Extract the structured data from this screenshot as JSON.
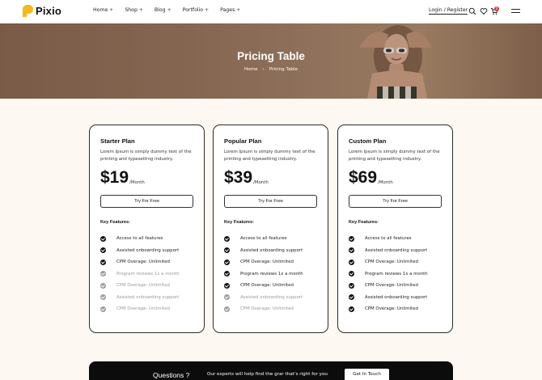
{
  "brand": {
    "name": "Pixio",
    "accent": "#f6b81d"
  },
  "nav": {
    "items": [
      {
        "label": "Home"
      },
      {
        "label": "Shop"
      },
      {
        "label": "Blog"
      },
      {
        "label": "Portfolio"
      },
      {
        "label": "Pages"
      }
    ],
    "expand_glyph": "+",
    "login_label": "Login / Register",
    "cart_count": "0"
  },
  "hero": {
    "title": "Pricing Table",
    "breadcrumb": {
      "home": "Home",
      "separator": "›",
      "current": "Pricing Table"
    }
  },
  "plans": [
    {
      "name": "Starter Plan",
      "description": "Lorem Ipsum is simply dummy text of the printing and typesetting industry.",
      "price": "$19",
      "period": "/Month",
      "cta": "Try For Free",
      "features_title": "Key Features:",
      "features": [
        {
          "label": "Access to all features",
          "included": true
        },
        {
          "label": "Assisted onboarding support",
          "included": true
        },
        {
          "label": "CPM Overage: Unlimited",
          "included": true
        },
        {
          "label": "Program reviews 1x a month",
          "included": false
        },
        {
          "label": "CPM Overage: Unlimited",
          "included": false
        },
        {
          "label": "Assisted onboarding support",
          "included": false
        },
        {
          "label": "CPM Overage: Unlimited",
          "included": false
        }
      ]
    },
    {
      "name": "Popular Plan",
      "description": "Lorem Ipsum is simply dummy text of the printing and typesetting industry.",
      "price": "$39",
      "period": "/Month",
      "cta": "Try For Free",
      "features_title": "Key Features:",
      "features": [
        {
          "label": "Access to all features",
          "included": true
        },
        {
          "label": "Assisted onboarding support",
          "included": true
        },
        {
          "label": "CPM Overage: Unlimited",
          "included": true
        },
        {
          "label": "Program reviews 1x a month",
          "included": true
        },
        {
          "label": "CPM Overage: Unlimited",
          "included": true
        },
        {
          "label": "Assisted onboarding support",
          "included": false
        },
        {
          "label": "CPM Overage: Unlimited",
          "included": false
        }
      ]
    },
    {
      "name": "Custom Plan",
      "description": "Lorem Ipsum is simply dummy text of the printing and typesetting industry.",
      "price": "$69",
      "period": "/Month",
      "cta": "Try For Free",
      "features_title": "Key Features:",
      "features": [
        {
          "label": "Access to all features",
          "included": true
        },
        {
          "label": "Assisted onboarding support",
          "included": true
        },
        {
          "label": "CPM Overage: Unlimited",
          "included": true
        },
        {
          "label": "Program reviews 1x a month",
          "included": true
        },
        {
          "label": "CPM Overage: Unlimited",
          "included": true
        },
        {
          "label": "Assisted onboarding support",
          "included": true
        },
        {
          "label": "CPM Overage: Unlimited",
          "included": true
        }
      ]
    }
  ],
  "cta_banner": {
    "question": "Questions ?",
    "text": "Our experts will help find the grar that’s right for you",
    "button": "Get In Touch"
  },
  "icons": [
    "search-icon",
    "heart-icon",
    "cart-icon",
    "menu-icon"
  ]
}
